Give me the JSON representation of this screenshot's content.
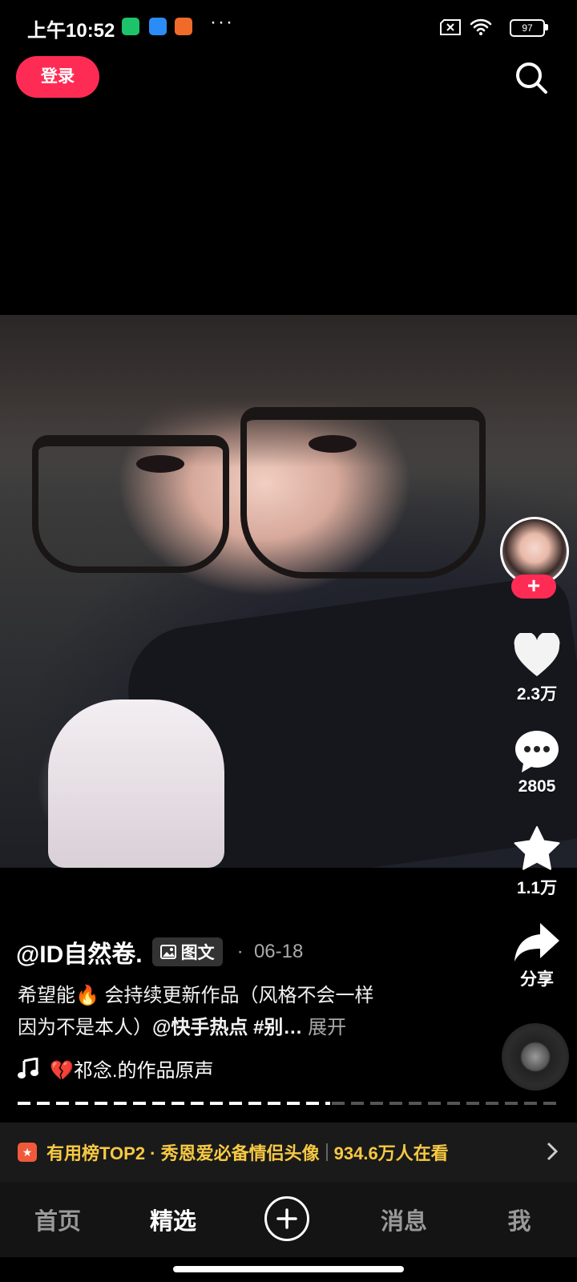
{
  "status_bar": {
    "time": "上午10:52",
    "battery": "97",
    "more": "···"
  },
  "top_bar": {
    "login_label": "登录"
  },
  "post": {
    "author": "@ID自然卷.",
    "type_badge": "图文",
    "separator": "·",
    "date": "06-18",
    "desc_line1": "希望能🔥 会持续更新作品（风格不会一样",
    "desc_line2_prefix": "因为不是本人）",
    "desc_mention": "@快手热点",
    "desc_tag": "#别…",
    "expand_label": "展开",
    "music": "💔祁念.的作品原声"
  },
  "actions": {
    "follow_symbol": "+",
    "likes": "2.3万",
    "comments": "2805",
    "favorites": "1.1万",
    "share_label": "分享"
  },
  "banner": {
    "text": "有用榜TOP2 · 秀恩爱必备情侣头像",
    "viewers": "934.6万人在看"
  },
  "nav": {
    "home": "首页",
    "featured": "精选",
    "add": "+",
    "messages": "消息",
    "me": "我"
  },
  "colors": {
    "accent": "#fe2c55",
    "banner_text": "#f7c943",
    "background": "#000000"
  },
  "icons": [
    "search-icon",
    "heart-icon",
    "comment-icon",
    "star-icon",
    "share-icon",
    "music-note-icon",
    "image-icon",
    "chevron-right-icon",
    "wifi-icon",
    "battery-icon"
  ]
}
